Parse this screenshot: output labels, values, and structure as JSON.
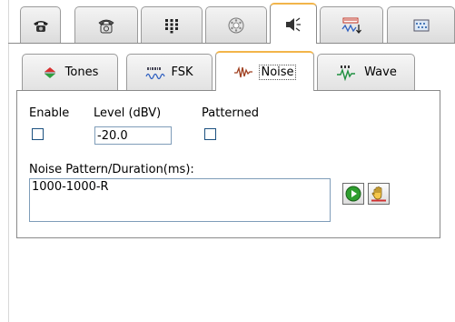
{
  "top_tabs": [
    {
      "icon": "phone-icon"
    },
    {
      "icon": "old-phone-icon"
    },
    {
      "icon": "keypad-icon"
    },
    {
      "icon": "dial-icon"
    },
    {
      "icon": "speaker-icon",
      "active": true
    },
    {
      "icon": "signal-icon"
    },
    {
      "icon": "display-icon"
    }
  ],
  "sub_tabs": [
    {
      "label": "Tones",
      "icon": "tones-icon"
    },
    {
      "label": "FSK",
      "icon": "fsk-icon"
    },
    {
      "label": "Noise",
      "icon": "noise-icon",
      "active": true
    },
    {
      "label": "Wave",
      "icon": "wave-icon"
    }
  ],
  "noise": {
    "enable_label": "Enable",
    "enable_checked": false,
    "level_label": "Level (dBV)",
    "level_value": "-20.0",
    "patterned_label": "Patterned",
    "patterned_checked": false,
    "pattern_label": "Noise Pattern/Duration(ms):",
    "pattern_value": "1000-1000-R"
  },
  "colors": {
    "active_tab_accent": "#f2b54a",
    "play_green": "#2e9e2e"
  }
}
